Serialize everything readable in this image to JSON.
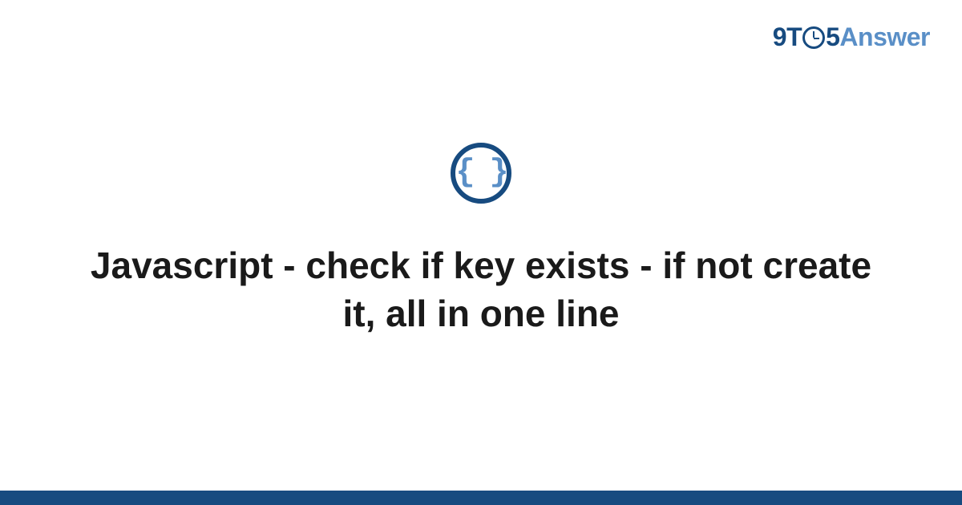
{
  "logo": {
    "part1": "9T",
    "part2": "5",
    "part3": "Answer"
  },
  "icon": {
    "name": "code-braces-icon",
    "glyph": "{ }"
  },
  "title": "Javascript - check if key exists - if not create it, all in one line",
  "colors": {
    "brand_dark": "#174b80",
    "brand_light": "#5a8fc7",
    "text": "#1a1a1a",
    "background": "#ffffff"
  }
}
